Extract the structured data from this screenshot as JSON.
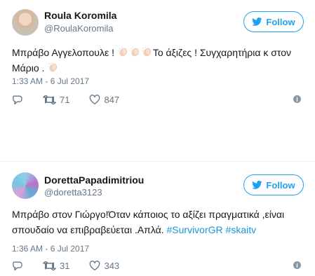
{
  "tweets": [
    {
      "name": "Roula Koromila",
      "handle": "@RoulaKoromila",
      "follow_label": "Follow",
      "text_part1": "Μπράβο Αγγελοπουλε !",
      "text_part2": "Το άξιζες ! Συγχαρητήρια κ στον Μάριο .",
      "timestamp": "1:33 AM - 6 Jul 2017",
      "retweets": "71",
      "likes": "847"
    },
    {
      "name": "DorettaPapadimitriou",
      "handle": "@doretta3123",
      "follow_label": "Follow",
      "text": "Μπράβο στον Γιώργο!Όταν κάποιος το αξίζει πραγματικά ,είναι σπουδαίο να επιβραβεύεται .Απλά.",
      "hashtag1": "#SurvivorGR",
      "hashtag2": "#skaitv",
      "timestamp": "1:36 AM - 6 Jul 2017",
      "retweets": "31",
      "likes": "343"
    }
  ],
  "icons": {
    "follow": "twitter-bird-icon",
    "reply": "reply-icon",
    "retweet": "retweet-icon",
    "like": "heart-icon",
    "info": "info-icon",
    "emoji": "clapping-hands-emoji"
  },
  "colors": {
    "accent": "#1da1f2",
    "hashtag": "#1b95e0",
    "meta": "#657786",
    "text": "#14171a"
  }
}
